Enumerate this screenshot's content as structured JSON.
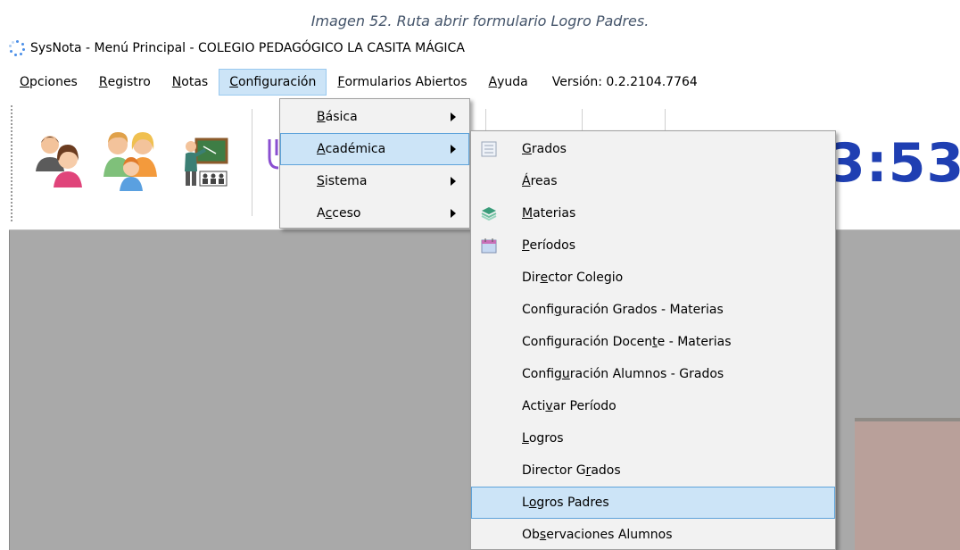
{
  "caption": "Imagen 52. Ruta abrir formulario Logro Padres.",
  "window": {
    "title": "SysNota - Menú Principal - COLEGIO PEDAGÓGICO LA CASITA MÁGICA"
  },
  "menubar": [
    {
      "u": "O",
      "rest": "pciones"
    },
    {
      "u": "R",
      "rest": "egistro"
    },
    {
      "u": "N",
      "rest": "otas"
    },
    {
      "u": "C",
      "rest": "onfiguración"
    },
    {
      "u": "F",
      "rest": "ormularios Abiertos"
    },
    {
      "u": "A",
      "rest": "yuda"
    }
  ],
  "version": "Versión: 0.2.2104.7764",
  "clock_text": "3:53",
  "config_menu": [
    {
      "u": "B",
      "rest": "ásica"
    },
    {
      "u": "A",
      "rest": "cadémica"
    },
    {
      "u": "S",
      "rest": "istema"
    },
    {
      "pre": "A",
      "u": "c",
      "rest": "ceso"
    }
  ],
  "academica_menu": [
    {
      "u": "G",
      "rest": "rados",
      "icon": "grid-list-icon"
    },
    {
      "u": "Á",
      "rest": "reas",
      "icon": ""
    },
    {
      "u": "M",
      "rest": "aterias",
      "icon": "layers-icon"
    },
    {
      "u": "P",
      "rest": "eríodos",
      "icon": "calendar-icon"
    },
    {
      "pre": "Dir",
      "u": "e",
      "rest": "ctor Colegio",
      "icon": ""
    },
    {
      "pre": "Confi",
      "u": "g",
      "rest": "uración Grados - Materias",
      "icon": ""
    },
    {
      "pre": "Configuración Docen",
      "u": "t",
      "rest": "e - Materias",
      "icon": ""
    },
    {
      "pre": "Config",
      "u": "u",
      "rest": "ración Alumnos - Grados",
      "icon": ""
    },
    {
      "pre": "Acti",
      "u": "v",
      "rest": "ar Período",
      "icon": ""
    },
    {
      "u": "L",
      "rest": "ogros",
      "icon": ""
    },
    {
      "pre": "Director G",
      "u": "r",
      "rest": "ados",
      "icon": ""
    },
    {
      "pre": "L",
      "u": "o",
      "rest": "gros Padres",
      "icon": ""
    },
    {
      "pre": "Ob",
      "u": "s",
      "rest": "ervaciones Alumnos",
      "icon": ""
    }
  ],
  "colors": {
    "highlight": "#cce4f7",
    "clock": "#1f3fb2",
    "caption": "#44546a"
  }
}
